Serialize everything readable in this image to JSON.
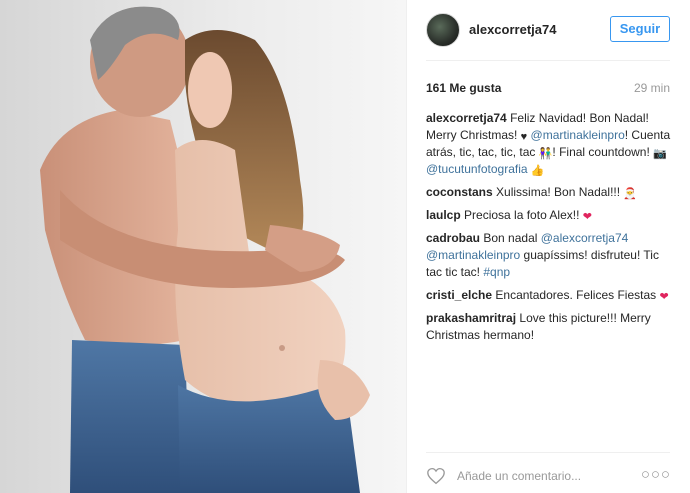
{
  "post": {
    "image_alt": "photo",
    "username": "alexcorretja74",
    "follow_label": "Seguir",
    "likes": "161 Me gusta",
    "time_ago": "29 min"
  },
  "comments": [
    {
      "user": "alexcorretja74",
      "parts": [
        {
          "t": "Feliz Navidad! Bon Nadal! Merry Christmas! "
        },
        {
          "emoji": "black-heart",
          "glyph": "♥"
        },
        {
          "t": " "
        },
        {
          "link": "@martinakleinpro"
        },
        {
          "t": "! Cuenta atrás, tic, tac, tic, tac "
        },
        {
          "emoji": "couple",
          "glyph": "👫"
        },
        {
          "t": "! Final countdown! "
        },
        {
          "emoji": "camera",
          "glyph": "📷"
        },
        {
          "t": " "
        },
        {
          "link": "@tucutunfotografia"
        },
        {
          "t": " "
        },
        {
          "emoji": "thumbs-up",
          "glyph": "👍"
        }
      ]
    },
    {
      "user": "coconstans",
      "parts": [
        {
          "t": "Xulissima! Bon Nadal!!! "
        },
        {
          "emoji": "santa",
          "glyph": "🎅"
        }
      ]
    },
    {
      "user": "laulcp",
      "parts": [
        {
          "t": "Preciosa la foto Alex!! "
        },
        {
          "emoji": "heart",
          "glyph": "❤"
        }
      ]
    },
    {
      "user": "cadrobau",
      "parts": [
        {
          "t": "Bon nadal "
        },
        {
          "link": "@alexcorretja74"
        },
        {
          "t": " "
        },
        {
          "link": "@martinakleinpro"
        },
        {
          "t": " guapíssims! disfruteu! Tic tac tic tac! "
        },
        {
          "link": "#qnp"
        }
      ]
    },
    {
      "user": "cristi_elche",
      "parts": [
        {
          "t": "Encantadores. Felices Fiestas "
        },
        {
          "emoji": "heart",
          "glyph": "❤"
        }
      ]
    },
    {
      "user": "prakashamritraj",
      "parts": [
        {
          "t": "Love this picture!!! Merry Christmas hermano!"
        }
      ]
    }
  ],
  "footer": {
    "add_comment_placeholder": "Añade un comentario...",
    "more_glyph": "○○○"
  }
}
